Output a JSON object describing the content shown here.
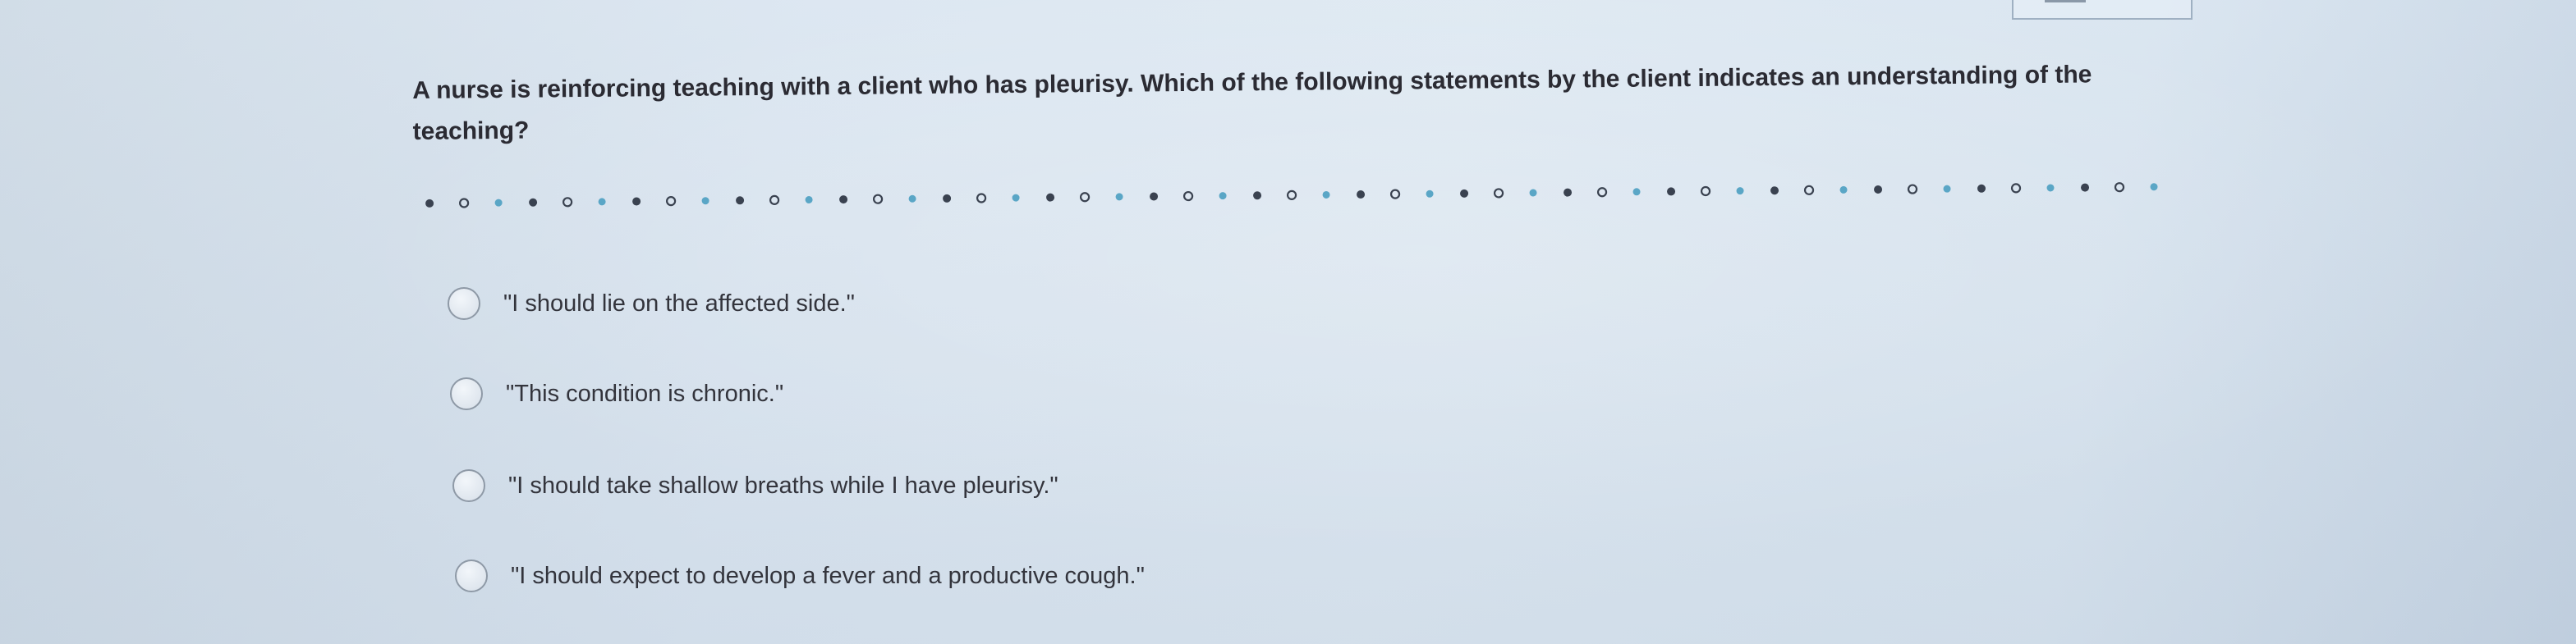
{
  "question": {
    "text": "A nurse is reinforcing teaching with a client who has pleurisy. Which of the following statements by the client indicates an understanding of the teaching?"
  },
  "options": [
    {
      "label": "\"I should lie on the affected side.\"",
      "selected": false
    },
    {
      "label": "\"This condition is chronic.\"",
      "selected": false
    },
    {
      "label": "\"I should take shallow breaths while I have pleurisy.\"",
      "selected": false
    },
    {
      "label": "\"I should expect to develop a fever and a productive cough.\"",
      "selected": false
    }
  ],
  "colors": {
    "text": "#2b2b33",
    "dot_dark": "#3a4250",
    "dot_teal": "#5aa6c6",
    "radio_border": "#8e99a6"
  }
}
